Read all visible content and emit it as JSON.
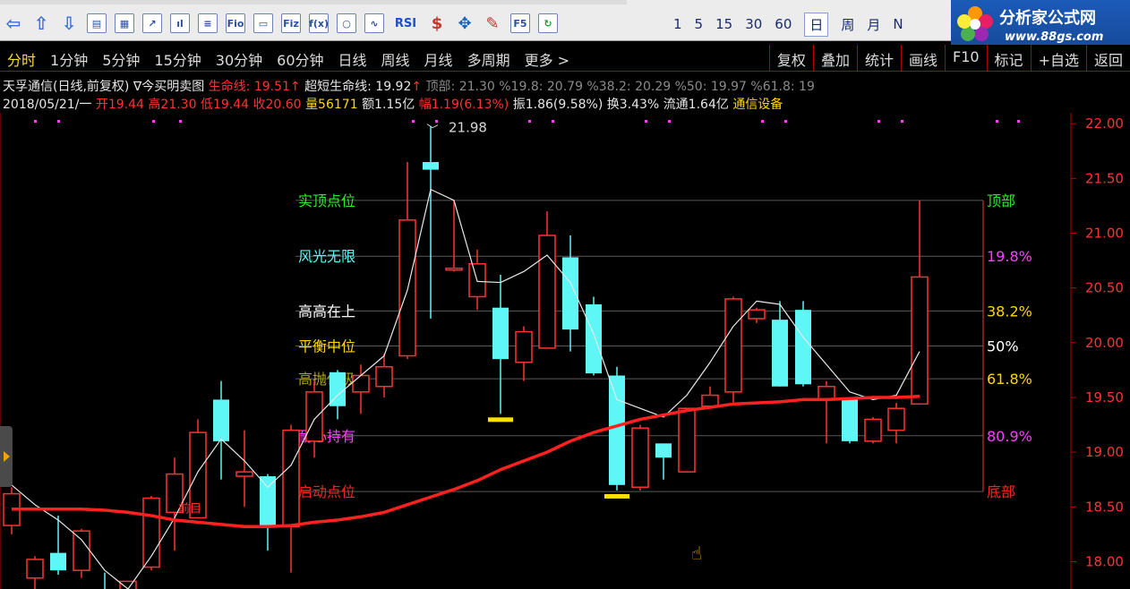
{
  "toolbar": {
    "periods": [
      "1",
      "5",
      "15",
      "30",
      "60",
      "日",
      "周",
      "月",
      "N"
    ],
    "selected_period": "日",
    "icons": [
      "back-arrow-icon",
      "up-arrow-icon",
      "down-arrow-icon",
      "f10-book-icon",
      "grid-icon",
      "line-chart-icon",
      "candle-icon",
      "list-icon",
      "fio-icon",
      "doc-icon",
      "fiz-icon",
      "fx-icon",
      "circle-icon",
      "wave-icon",
      "rsi-icon",
      "dollar-icon",
      "move-icon",
      "pencil-icon",
      "f5-icon",
      "refresh-icon"
    ],
    "icon_labels": {
      "fio": "Fio",
      "fiz": "Fiz",
      "fx": "f(x)",
      "rsi": "RSI",
      "dollar": "$",
      "f5": "F5"
    }
  },
  "logo": {
    "title": "分析家公式网",
    "url": "www.88gs.com"
  },
  "period_bar": {
    "tabs": [
      "分时",
      "1分钟",
      "5分钟",
      "15分钟",
      "30分钟",
      "60分钟",
      "日线",
      "周线",
      "月线",
      "多周期",
      "更多 >"
    ],
    "active_tab": "分时",
    "right_buttons": [
      "复权",
      "叠加",
      "统计",
      "画线",
      "F10",
      "标记",
      "+自选",
      "返回"
    ]
  },
  "info_line1": {
    "stock": "天孚通信(日线,前复权)",
    "indicator": "∇今买明卖图",
    "life_label": "生命线:",
    "life_value": "19.51",
    "short_label": "超短生命线:",
    "short_value": "19.92",
    "levels": "顶部: 21.30  %19.8: 20.79  %38.2: 20.29  %50: 19.97  %61.8: 19"
  },
  "info_line2": {
    "date": "2018/05/21/一",
    "open": "开19.44",
    "high": "高21.30",
    "low": "低19.44",
    "close": "收20.60",
    "volume": "量56171",
    "amount": "额1.15亿",
    "change": "幅1.19(6.13%)",
    "amplitude": "振1.86(9.58%)",
    "turnover": "换3.43%",
    "float": "流通1.64亿",
    "sector": "通信设备"
  },
  "chart_data": {
    "type": "candlestick",
    "y_axis": {
      "min": 17.75,
      "max": 22.1,
      "ticks": [
        "22.00",
        "21.50",
        "21.00",
        "20.50",
        "20.00",
        "19.50",
        "19.00",
        "18.50",
        "18.00"
      ]
    },
    "peak_label": "21.98",
    "colors": {
      "up": "#ff3232",
      "down": "#5ff6f6",
      "life_line": "#ff2020",
      "short_line": "#e8e8e8",
      "grid": "#5a5a5a",
      "bg": "#000000"
    },
    "level_lines": [
      {
        "left_text": "实顶点位",
        "right_text": "顶部",
        "value": 21.3,
        "left_color": "#2ee82e",
        "right_color": "#2ee82e"
      },
      {
        "left_text": "风光无限",
        "right_text": "19.8%",
        "value": 20.79,
        "left_color": "#5ff6f6",
        "right_color": "#ff3cff"
      },
      {
        "left_text": "高高在上",
        "right_text": "38.2%",
        "value": 20.29,
        "left_color": "#ffffff",
        "right_color": "#ffd700"
      },
      {
        "left_text": "平衡中位",
        "right_text": "50%",
        "value": 19.97,
        "left_color": "#ffd700",
        "right_color": "#ffffff"
      },
      {
        "left_text": "高抛低吸",
        "right_text": "61.8%",
        "value": 19.67,
        "left_color": "#b3a600",
        "right_color": "#ffd700"
      },
      {
        "left_text": "耐心持有",
        "right_text": "80.9%",
        "value": 19.15,
        "left_color": "#ff3cff",
        "right_color": "#ff3cff"
      },
      {
        "left_text": "启动点位",
        "right_text": "底部",
        "value": 18.64,
        "left_color": "#ff2020",
        "right_color": "#ff2020"
      }
    ],
    "candles": [
      {
        "o": 18.33,
        "h": 18.68,
        "c": 18.62,
        "l": 18.25
      },
      {
        "o": 17.85,
        "h": 18.05,
        "c": 18.02,
        "l": 17.62
      },
      {
        "o": 18.08,
        "h": 18.42,
        "c": 17.92,
        "l": 17.88
      },
      {
        "o": 17.92,
        "h": 18.3,
        "c": 18.28,
        "l": 17.85
      },
      {
        "o": 17.62,
        "h": 17.9,
        "c": 17.55,
        "l": 17.5
      },
      {
        "o": 17.55,
        "h": 17.82,
        "c": 17.82,
        "l": 17.5
      },
      {
        "o": 17.95,
        "h": 18.6,
        "c": 18.58,
        "l": 17.92
      },
      {
        "o": 18.45,
        "h": 18.95,
        "c": 18.8,
        "l": 18.1
      },
      {
        "o": 18.4,
        "h": 19.3,
        "c": 19.18,
        "l": 18.4
      },
      {
        "o": 19.48,
        "h": 19.65,
        "c": 19.1,
        "l": 18.75
      },
      {
        "o": 18.78,
        "h": 19.2,
        "c": 18.82,
        "l": 18.5
      },
      {
        "o": 18.78,
        "h": 18.8,
        "c": 18.32,
        "l": 18.1
      },
      {
        "o": 18.32,
        "h": 19.25,
        "c": 19.2,
        "l": 17.9
      },
      {
        "o": 19.1,
        "h": 19.65,
        "c": 19.55,
        "l": 18.95
      },
      {
        "o": 19.73,
        "h": 19.75,
        "c": 19.42,
        "l": 19.3
      },
      {
        "o": 19.55,
        "h": 19.8,
        "c": 19.7,
        "l": 19.35
      },
      {
        "o": 19.6,
        "h": 19.9,
        "c": 19.78,
        "l": 19.5
      },
      {
        "o": 19.88,
        "h": 21.65,
        "c": 21.12,
        "l": 19.85
      },
      {
        "o": 21.65,
        "h": 21.98,
        "c": 21.58,
        "l": 20.22
      },
      {
        "o": 20.68,
        "h": 21.3,
        "c": 20.68,
        "l": 20.65
      },
      {
        "o": 20.42,
        "h": 20.85,
        "c": 20.72,
        "l": 20.3
      },
      {
        "o": 20.32,
        "h": 20.62,
        "c": 19.85,
        "l": 19.35
      },
      {
        "o": 19.82,
        "h": 20.15,
        "c": 20.1,
        "l": 19.65
      },
      {
        "o": 19.95,
        "h": 21.2,
        "c": 20.98,
        "l": 19.95
      },
      {
        "o": 20.78,
        "h": 20.98,
        "c": 20.12,
        "l": 19.92
      },
      {
        "o": 20.35,
        "h": 20.42,
        "c": 19.72,
        "l": 19.7
      },
      {
        "o": 19.7,
        "h": 19.78,
        "c": 18.7,
        "l": 18.65
      },
      {
        "o": 18.68,
        "h": 19.25,
        "c": 19.22,
        "l": 18.65
      },
      {
        "o": 19.08,
        "h": 19.05,
        "c": 18.95,
        "l": 18.75
      },
      {
        "o": 18.82,
        "h": 19.4,
        "c": 19.4,
        "l": 18.82
      },
      {
        "o": 19.42,
        "h": 19.6,
        "c": 19.52,
        "l": 19.4
      },
      {
        "o": 19.55,
        "h": 20.42,
        "c": 20.4,
        "l": 19.45
      },
      {
        "o": 20.22,
        "h": 20.32,
        "c": 20.3,
        "l": 20.18
      },
      {
        "o": 20.21,
        "h": 20.38,
        "c": 19.6,
        "l": 19.6
      },
      {
        "o": 20.3,
        "h": 20.38,
        "c": 19.62,
        "l": 19.6
      },
      {
        "o": 19.48,
        "h": 19.65,
        "c": 19.6,
        "l": 19.08
      },
      {
        "o": 19.48,
        "h": 19.48,
        "c": 19.1,
        "l": 19.08
      },
      {
        "o": 19.1,
        "h": 19.32,
        "c": 19.3,
        "l": 19.08
      },
      {
        "o": 19.2,
        "h": 19.45,
        "c": 19.4,
        "l": 19.08
      },
      {
        "o": 19.44,
        "h": 21.3,
        "c": 20.6,
        "l": 19.44
      }
    ],
    "life_line": [
      18.48,
      18.48,
      18.48,
      18.48,
      18.47,
      18.45,
      18.42,
      18.38,
      18.36,
      18.34,
      18.32,
      18.32,
      18.33,
      18.36,
      18.38,
      18.41,
      18.45,
      18.52,
      18.59,
      18.66,
      18.74,
      18.84,
      18.92,
      19.0,
      19.1,
      19.18,
      19.24,
      19.3,
      19.34,
      19.38,
      19.41,
      19.44,
      19.45,
      19.46,
      19.48,
      19.48,
      19.49,
      19.5,
      19.5,
      19.51
    ],
    "short_line": [
      18.7,
      18.52,
      18.38,
      18.2,
      17.92,
      17.75,
      18.05,
      18.4,
      18.82,
      19.12,
      18.92,
      18.68,
      18.88,
      19.3,
      19.52,
      19.7,
      19.88,
      20.48,
      21.4,
      21.3,
      20.56,
      20.55,
      20.65,
      20.8,
      20.55,
      20.08,
      19.48,
      19.4,
      19.32,
      19.52,
      19.82,
      20.15,
      20.38,
      20.35,
      20.05,
      19.8,
      19.55,
      19.48,
      19.52,
      19.92
    ],
    "yellow_markers": [
      21,
      26
    ],
    "red_label": {
      "index": 7,
      "text": "前目"
    }
  }
}
